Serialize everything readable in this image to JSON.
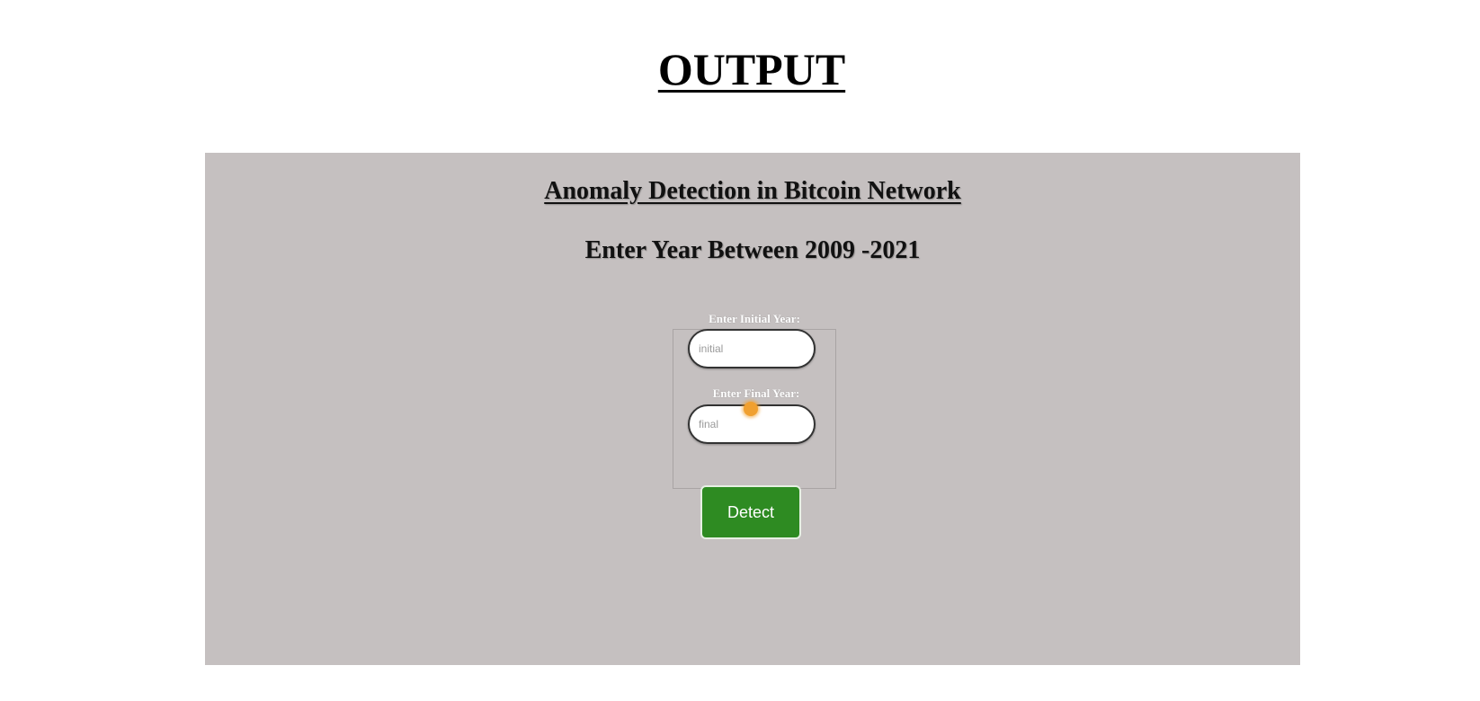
{
  "page": {
    "title": "OUTPUT"
  },
  "app": {
    "heading": "Anomaly Detection in Bitcoin Network",
    "subheading": "Enter Year Between 2009 -2021",
    "form": {
      "initial_label": "Enter Initial Year:",
      "initial_placeholder": "initial",
      "final_label": "Enter Final Year:",
      "final_placeholder": "final",
      "detect_label": "Detect"
    }
  },
  "colors": {
    "panel_background": "#c5c0c0",
    "button_green": "#2e8b22",
    "cursor_highlight": "#f0a030"
  }
}
